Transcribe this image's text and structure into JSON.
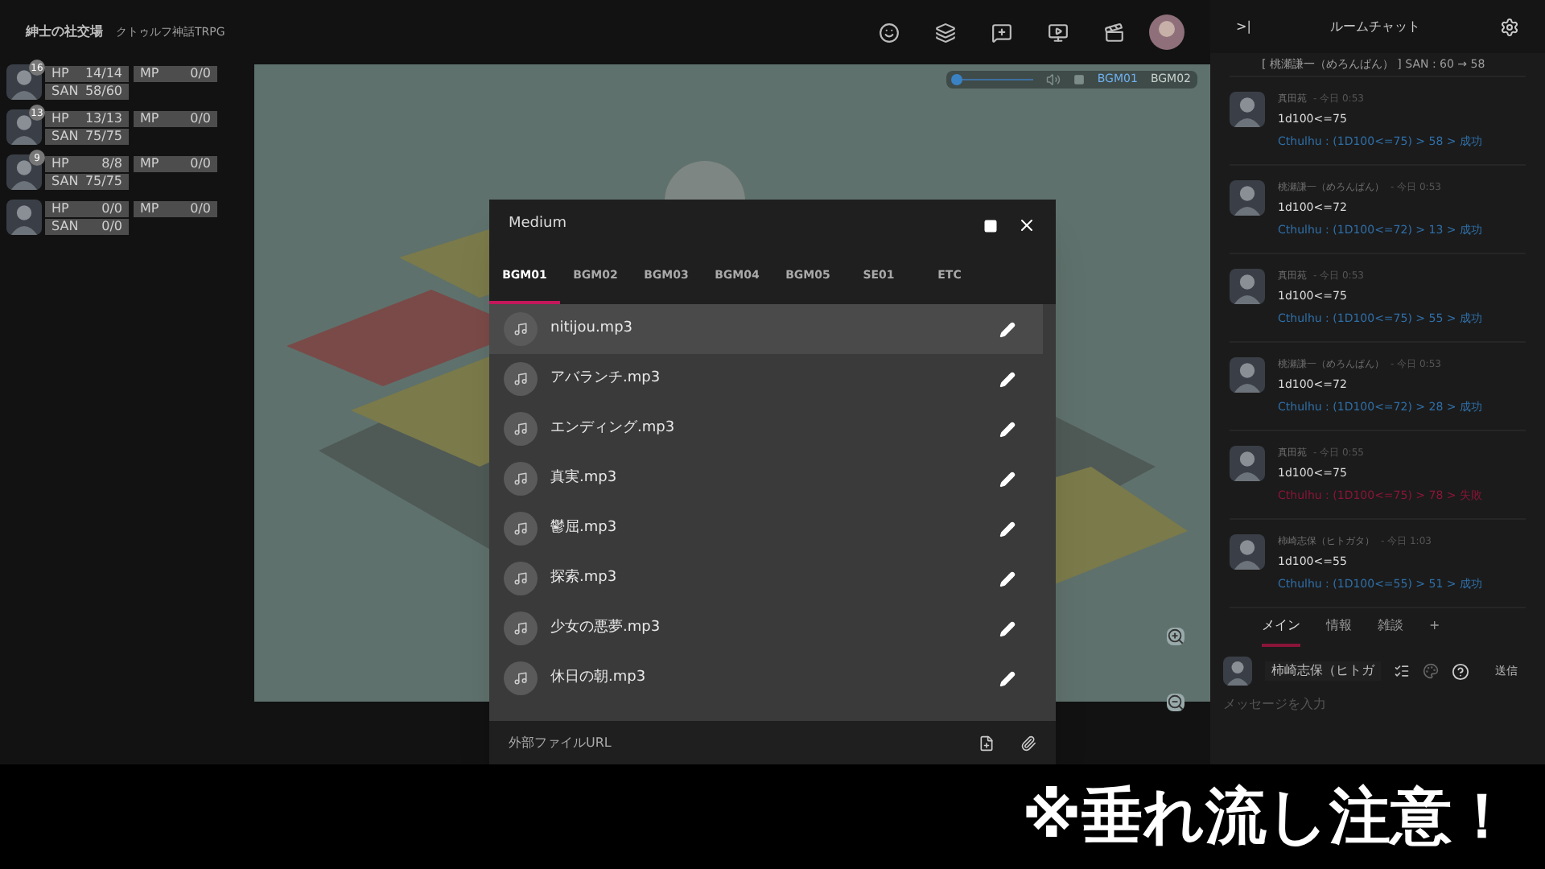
{
  "header": {
    "room": "紳士の社交場",
    "system": "クトゥルフ神話TRPG"
  },
  "characters": [
    {
      "badge": "16",
      "hp_label": "HP",
      "hp": "14/14",
      "mp_label": "MP",
      "mp": "0/0",
      "san_label": "SAN",
      "san": "58/60"
    },
    {
      "badge": "13",
      "hp_label": "HP",
      "hp": "13/13",
      "mp_label": "MP",
      "mp": "0/0",
      "san_label": "SAN",
      "san": "75/75"
    },
    {
      "badge": "9",
      "hp_label": "HP",
      "hp": "8/8",
      "mp_label": "MP",
      "mp": "0/0",
      "san_label": "SAN",
      "san": "75/75"
    },
    {
      "hp_label": "HP",
      "hp": "0/0",
      "mp_label": "MP",
      "mp": "0/0",
      "san_label": "SAN",
      "san": "0/0"
    }
  ],
  "player": {
    "volume": {
      "level": 0.05
    },
    "channels": [
      {
        "label": "BGM01",
        "selected": true
      },
      {
        "label": "BGM02",
        "selected": false
      }
    ]
  },
  "modal": {
    "title": "Medium",
    "tabs": [
      {
        "label": "BGM01",
        "selected": true
      },
      {
        "label": "BGM02",
        "selected": false
      },
      {
        "label": "BGM03",
        "selected": false
      },
      {
        "label": "BGM04",
        "selected": false
      },
      {
        "label": "BGM05",
        "selected": false
      },
      {
        "label": "SE01",
        "selected": false
      },
      {
        "label": "ETC",
        "selected": false
      }
    ],
    "tracks": [
      {
        "name": "nitijou.mp3",
        "selected": true
      },
      {
        "name": "アバランチ.mp3",
        "selected": false
      },
      {
        "name": "エンディング.mp3",
        "selected": false
      },
      {
        "name": "真実.mp3",
        "selected": false
      },
      {
        "name": "鬱屈.mp3",
        "selected": false
      },
      {
        "name": "探索.mp3",
        "selected": false
      },
      {
        "name": "少女の悪夢.mp3",
        "selected": false
      },
      {
        "name": "休日の朝.mp3",
        "selected": false
      }
    ],
    "footer": "外部ファイルURL"
  },
  "chat": {
    "collapse": ">|",
    "title": "ルームチャット",
    "system_message": "[ 桃瀬謙一（めろんぱん） ] SAN : 60 → 58",
    "messages": [
      {
        "name": "真田苑",
        "time": "- 今日 0:53",
        "command": "1d100<=75",
        "result": "Cthulhu : (1D100<=75) > 58 > 成功",
        "color": "#2f6fa8"
      },
      {
        "name": "桃瀬謙一（めろんぱん）",
        "time": "- 今日 0:53",
        "command": "1d100<=72",
        "result": "Cthulhu : (1D100<=72) > 13 > 成功",
        "color": "#2f6fa8"
      },
      {
        "name": "真田苑",
        "time": "- 今日 0:53",
        "command": "1d100<=75",
        "result": "Cthulhu : (1D100<=75) > 55 > 成功",
        "color": "#2f6fa8"
      },
      {
        "name": "桃瀬謙一（めろんぱん）",
        "time": "- 今日 0:53",
        "command": "1d100<=72",
        "result": "Cthulhu : (1D100<=72) > 28 > 成功",
        "color": "#2f6fa8"
      },
      {
        "name": "真田苑",
        "time": "- 今日 0:55",
        "command": "1d100<=75",
        "result": "Cthulhu : (1D100<=75) > 78 > 失敗",
        "color": "#8a1538"
      },
      {
        "name": "柿崎志保（ヒトガタ）",
        "time": "- 今日 1:03",
        "command": "1d100<=55",
        "result": "Cthulhu : (1D100<=55) > 51 > 成功",
        "color": "#2f6fa8"
      }
    ],
    "tabs": [
      {
        "label": "メイン",
        "selected": true
      },
      {
        "label": "情報",
        "selected": false
      },
      {
        "label": "雑談",
        "selected": false
      },
      {
        "label": "+",
        "selected": false
      }
    ],
    "speaker": "柿崎志保（ヒトガ",
    "send": "送信",
    "placeholder": "メッセージを入力"
  },
  "caption": "※垂れ流し注意！"
}
